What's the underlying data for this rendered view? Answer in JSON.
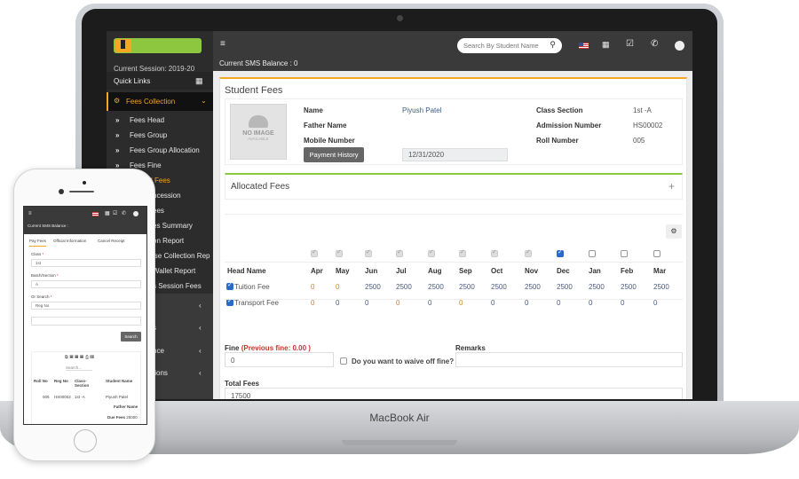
{
  "device": {
    "laptop_label": "MacBook Air"
  },
  "app": {
    "session": "Current Session: 2019-20",
    "quick_links": "Quick Links",
    "sms_balance": "Current SMS Balance : 0",
    "search_placeholder": "Search By Student Name",
    "sidebar": {
      "active_group": "Fees Collection",
      "items": [
        "Fees Head",
        "Fees Group",
        "Fees Group Allocation",
        "Fees Fine"
      ],
      "partially_hidden_items": [
        "l Fees",
        "ncession",
        "ees",
        "es Summary",
        "on Report",
        "ise Collection Rep",
        "Wallet Report",
        "s Session Fees"
      ],
      "collapsed_groups": [
        "",
        "s",
        "nce",
        "tions"
      ]
    },
    "student_fees": {
      "title": "Student Fees",
      "photo_text": "NO IMAGE",
      "photo_sub": "AVAILABLE",
      "fields": [
        {
          "label": "Name",
          "value": "Piyush Patel"
        },
        {
          "label": "Father Name",
          "value": ""
        },
        {
          "label": "Mobile Number",
          "value": ""
        },
        {
          "label": "Class Section",
          "value": "1st -A"
        },
        {
          "label": "Admission Number",
          "value": "HS00002"
        },
        {
          "label": "Roll Number",
          "value": "005"
        }
      ],
      "payment_history": "Payment History",
      "date": "12/31/2020",
      "allocated_title": "Allocated Fees",
      "head_name": "Head Name",
      "months": [
        "Apr",
        "May",
        "Jun",
        "Jul",
        "Aug",
        "Sep",
        "Oct",
        "Nov",
        "Dec",
        "Jan",
        "Feb",
        "Mar"
      ],
      "month_checks": [
        "paid",
        "paid",
        "paid",
        "paid",
        "paid",
        "paid",
        "paid",
        "paid",
        "checked",
        "unchecked",
        "unchecked",
        "unchecked"
      ],
      "rows": [
        {
          "name": "Tuition Fee",
          "checked": true,
          "values": [
            "0",
            "0",
            "2500",
            "2500",
            "2500",
            "2500",
            "2500",
            "2500",
            "2500",
            "2500",
            "2500",
            "2500"
          ]
        },
        {
          "name": "Transport Fee",
          "checked": true,
          "values": [
            "0",
            "0",
            "0",
            "0",
            "0",
            "0",
            "0",
            "0",
            "0",
            "0",
            "0",
            "0"
          ]
        }
      ],
      "fine_label": "Fine",
      "prev_fine": "(Previous fine: 0.00 )",
      "fine_value": "0",
      "waive_label": "Do you want to waive off fine?",
      "remarks_label": "Remarks",
      "total_label": "Total Fees",
      "total_value": "17500"
    }
  },
  "phone": {
    "sms_balance": "Current SMS Balance :",
    "tabs": [
      "Pay Fees",
      "Official Information",
      "Cancel Receipt"
    ],
    "class_label": "Class",
    "class_value": "1st",
    "batch_label": "Batch/Section",
    "batch_value": "A",
    "or_search_label": "Or Search",
    "or_search_value": "Reg No",
    "search_button": "Search",
    "table_search": "Search...",
    "columns": [
      "Roll No",
      "Reg No",
      "Class-Section",
      "Student Name"
    ],
    "row": [
      "005",
      "HS00002",
      "1st -A",
      "Piyush Patel"
    ],
    "father_label": "Father Name",
    "due_label": "Due Fees",
    "due_value": "25000"
  },
  "colors": {
    "accent_orange": "#f5a623",
    "accent_green": "#8dc63f",
    "dark": "#3a3a3a",
    "checkbox_blue": "#2a6ac8",
    "fine_red": "#c0392b"
  }
}
